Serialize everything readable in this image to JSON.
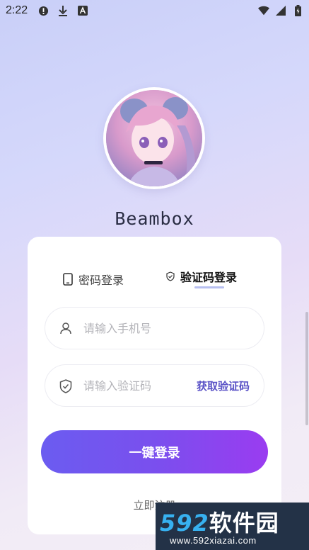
{
  "status_bar": {
    "time": "2:22",
    "icons_left": [
      "alert-circle-icon",
      "download-icon",
      "text-a-icon"
    ],
    "icons_right": [
      "wifi-icon",
      "signal-icon",
      "battery-icon"
    ]
  },
  "brand": {
    "name": "Beambox"
  },
  "tabs": {
    "password_login": "密码登录",
    "code_login": "验证码登录",
    "active": "code_login"
  },
  "form": {
    "phone_placeholder": "请输入手机号",
    "phone_value": "",
    "code_placeholder": "请输入验证码",
    "code_value": "",
    "get_code_label": "获取验证码"
  },
  "actions": {
    "login_label": "一键登录",
    "register_label": "立即注册"
  },
  "watermark": {
    "logo_num": "592",
    "logo_cn": "软件园",
    "url": "www.592xiazai.com"
  },
  "colors": {
    "accent": "#6b5cf0",
    "accent_end": "#9a3cf0",
    "link": "#5b53c7"
  }
}
